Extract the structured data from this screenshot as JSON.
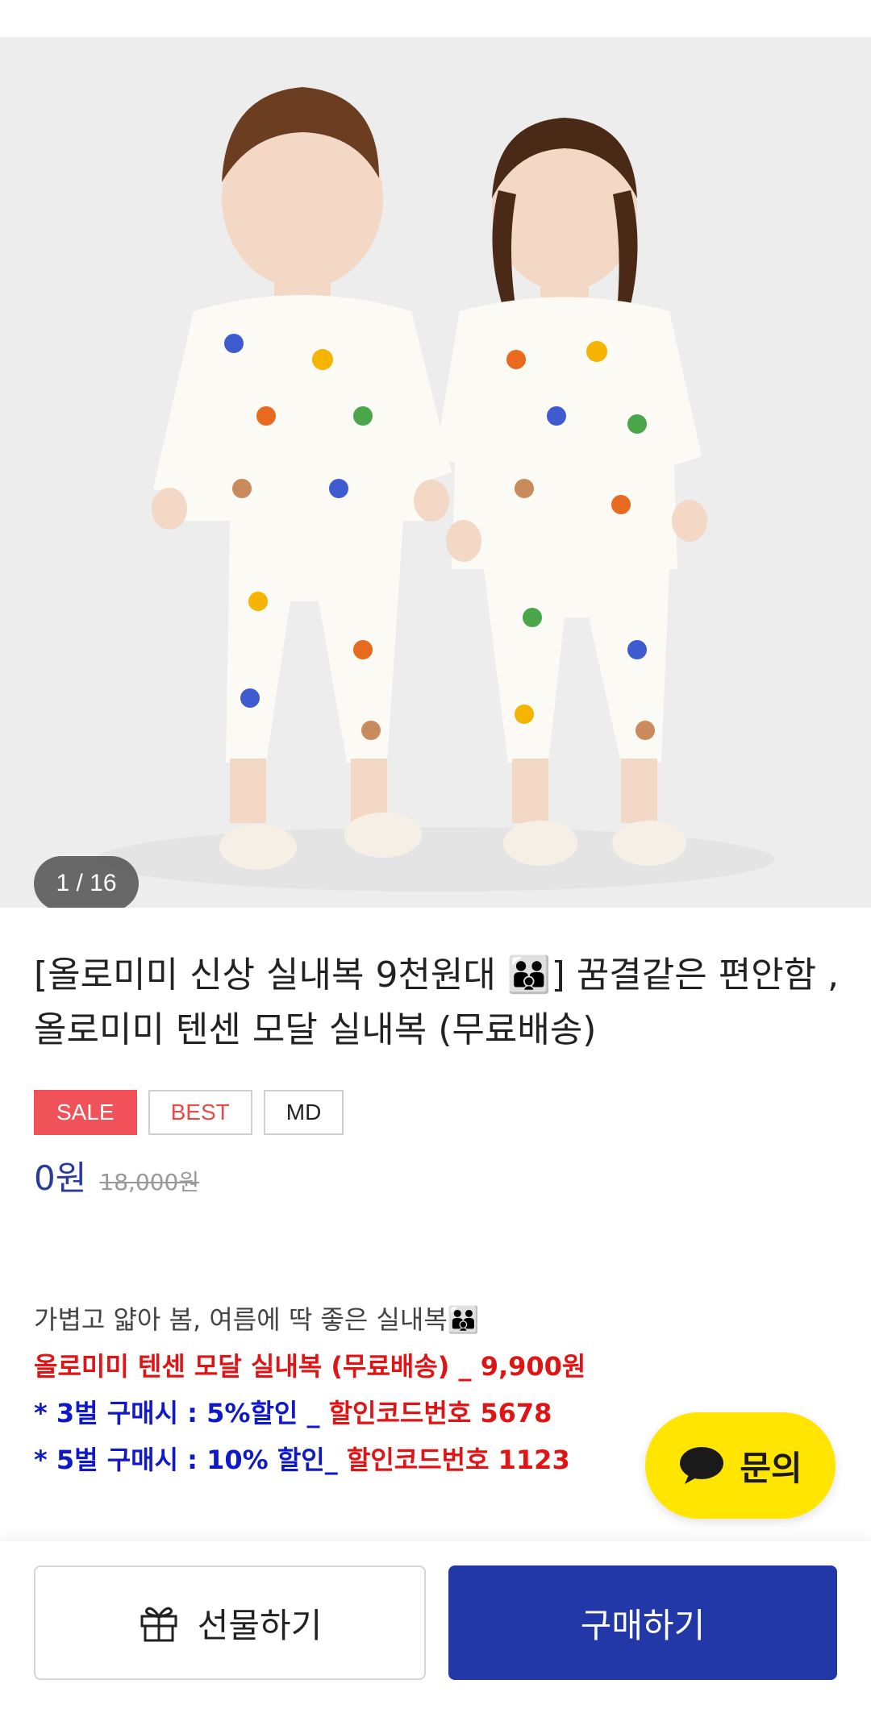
{
  "gallery": {
    "counter": "1 / 16",
    "image_alt": "two children in matching bear print pajamas"
  },
  "product": {
    "title": "[올로미미 신상 실내복 9천원대 👪] 꿈결같은 편안함 , 올로미미 텐센 모달 실내복 (무료배송)",
    "badges": {
      "sale": "SALE",
      "best": "BEST",
      "md": "MD"
    },
    "price": "0원",
    "original_price": "18,000원"
  },
  "description": {
    "intro": "가볍고 얇아 봄, 여름에 딱 좋은 실내복👪",
    "line_red": "올로미미 텐센 모달 실내복 (무료배송) _ 9,900원",
    "line3_blue": "* 3벌 구매시 : 5%할인 _ ",
    "line3_red": "할인코드번호 5678",
    "line5_blue": "* 5벌 구매시 : 10% 할인_ ",
    "line5_red": "할인코드번호 1123"
  },
  "chat": {
    "label": "문의",
    "icon": "speech-bubble-icon",
    "color": "#ffe500"
  },
  "actions": {
    "gift_label": "선물하기",
    "gift_icon": "gift-icon",
    "buy_label": "구매하기",
    "buy_color": "#2338a8"
  },
  "colors": {
    "sale_badge": "#f1525a",
    "price": "#2b3aa0",
    "promo_red": "#e01414",
    "promo_blue": "#1019c8"
  }
}
